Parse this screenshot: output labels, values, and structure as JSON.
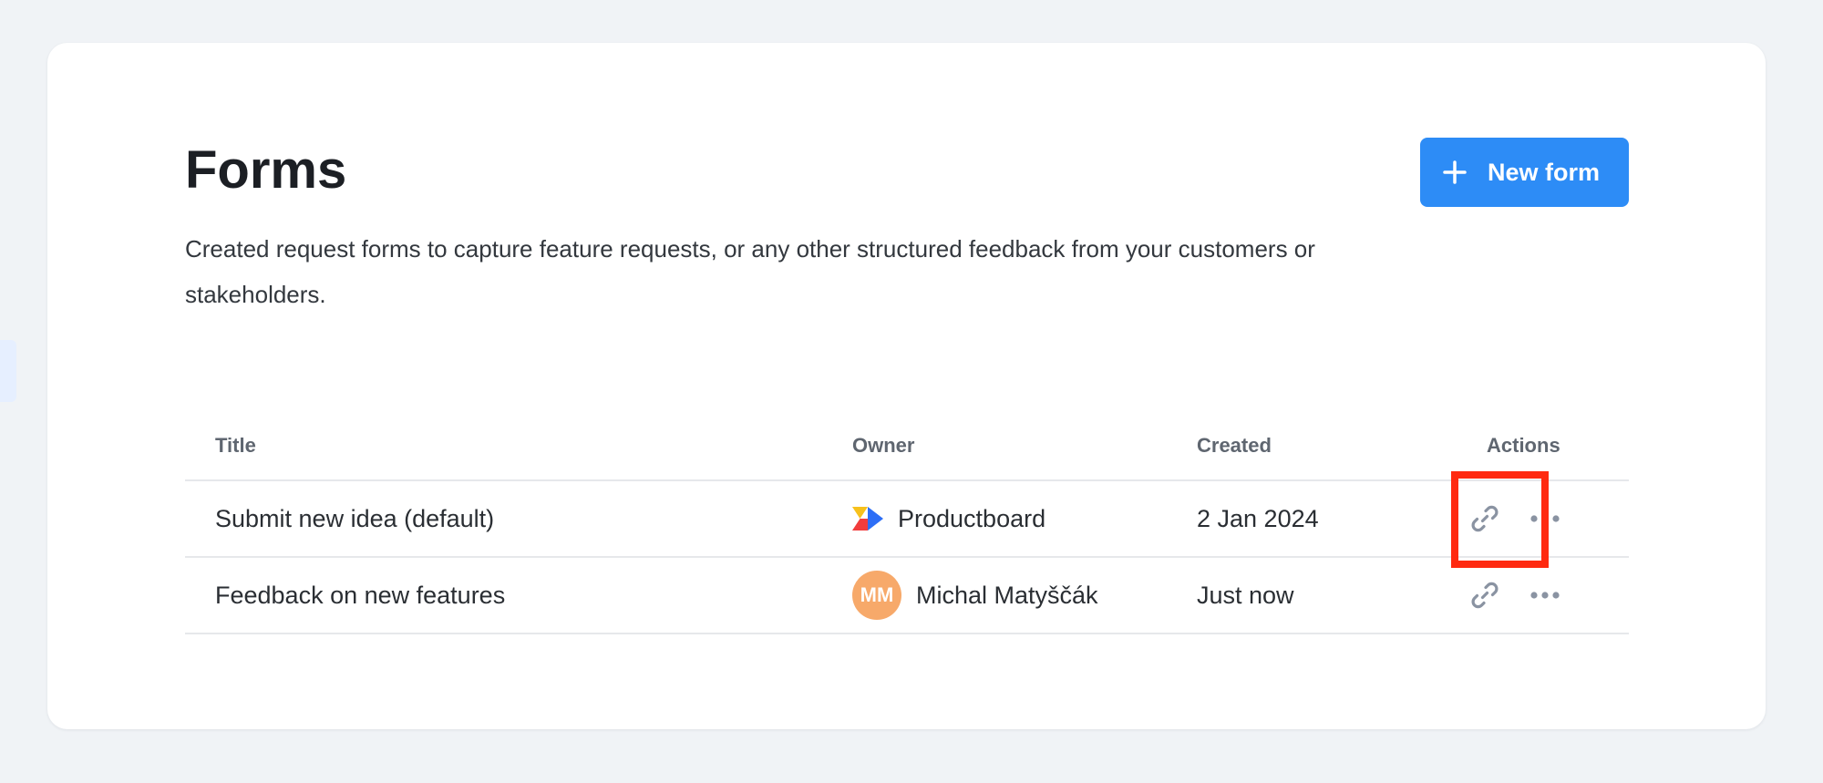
{
  "header": {
    "title": "Forms",
    "description": "Created request forms to capture feature requests, or any other structured feedback from your customers or stakeholders.",
    "new_form_label": "New form"
  },
  "table": {
    "columns": [
      "Title",
      "Owner",
      "Created",
      "Actions"
    ],
    "rows": [
      {
        "title": "Submit new idea (default)",
        "owner": "Productboard",
        "owner_icon": "productboard-logo-icon",
        "created": "2 Jan 2024",
        "actions": [
          "link-icon",
          "more-icon"
        ]
      },
      {
        "title": "Feedback on new features",
        "owner": "Michal Matyščák",
        "owner_initials": "MM",
        "created": "Just now",
        "actions": [
          "link-icon",
          "more-icon"
        ]
      }
    ]
  },
  "colors": {
    "page_background": "#f0f3f6",
    "primary_button": "#2d8cf6",
    "avatar": "#f7a96a",
    "highlight": "#ff2a10",
    "icon": "#8a93a2"
  }
}
